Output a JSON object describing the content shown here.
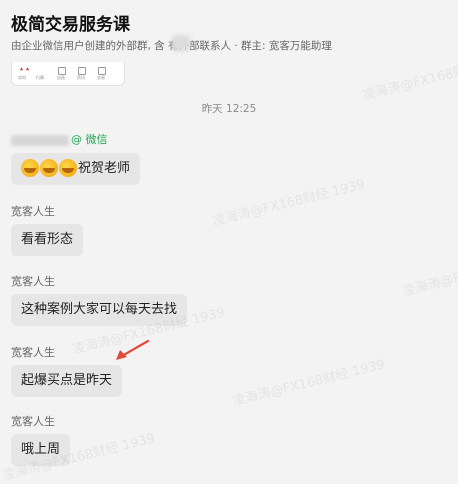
{
  "header": {
    "title": "极简交易服务课",
    "subtitle": "由企业微信用户创建的外部群, 含   有外部联系人 · 群主: 宽客万能助理"
  },
  "thumbnail": {
    "labels": [
      "实时",
      "行情",
      "自选",
      "资讯",
      "交易"
    ]
  },
  "chat": {
    "timestamp": "昨天 12:25",
    "messages": [
      {
        "sender": "@ 微信",
        "sender_is_wechat": true,
        "text": "祝贺老师",
        "emoji_count": 3
      },
      {
        "sender": "宽客人生",
        "text": "看看形态"
      },
      {
        "sender": "宽客人生",
        "text": "这种案例大家可以每天去找"
      },
      {
        "sender": "宽客人生",
        "text": "起爆买点是昨天"
      },
      {
        "sender": "宽客人生",
        "text": "哦上周"
      }
    ]
  },
  "watermark": {
    "text": "凌海涛@FX168财经 1939"
  },
  "colors": {
    "background": "#f3f3f3",
    "bubble": "#e6e6e6",
    "wechat_green": "#20a853",
    "arrow_red": "#e04a3a"
  }
}
